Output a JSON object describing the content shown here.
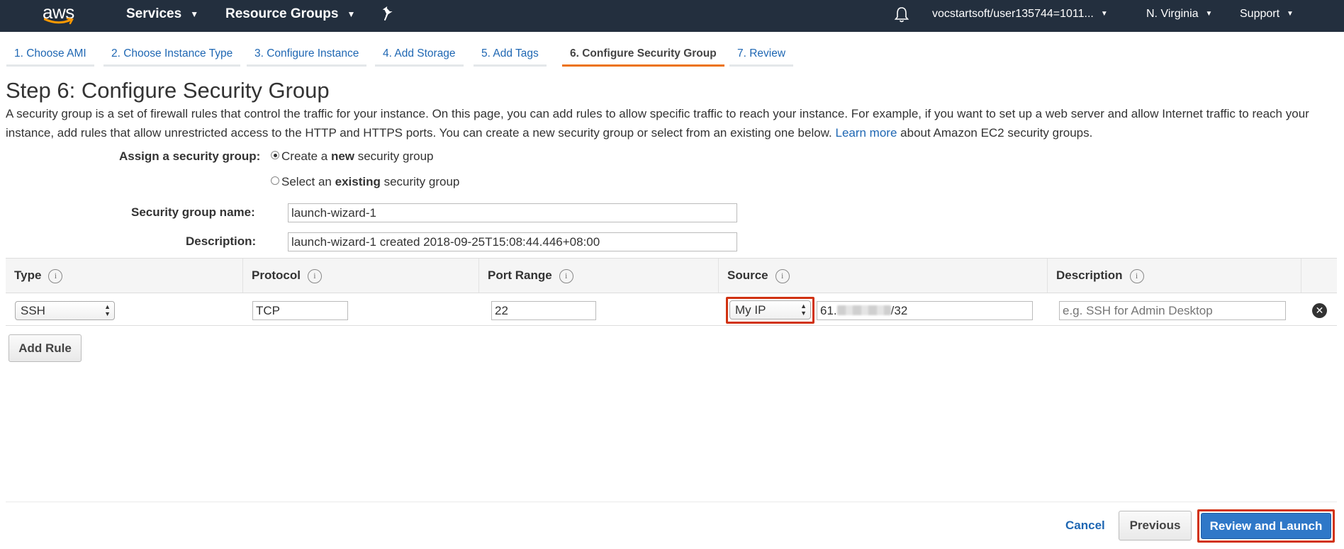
{
  "topbar": {
    "logo_text": "aws",
    "services": "Services",
    "resource_groups": "Resource Groups",
    "account": "vocstartsoft/user135744=1011...",
    "region": "N. Virginia",
    "support": "Support"
  },
  "tabs": [
    {
      "label": "1. Choose AMI"
    },
    {
      "label": "2. Choose Instance Type"
    },
    {
      "label": "3. Configure Instance"
    },
    {
      "label": "4. Add Storage"
    },
    {
      "label": "5. Add Tags"
    },
    {
      "label": "6. Configure Security Group",
      "active": true
    },
    {
      "label": "7. Review"
    }
  ],
  "page": {
    "title": "Step 6: Configure Security Group",
    "intro_text": "A security group is a set of firewall rules that control the traffic for your instance. On this page, you can add rules to allow specific traffic to reach your instance. For example, if you want to set up a web server and allow Internet traffic to reach your instance, add rules that allow unrestricted access to the HTTP and HTTPS ports. You can create a new security group or select from an existing one below.",
    "learn_more": "Learn more",
    "intro_suffix": "about Amazon EC2 security groups."
  },
  "form": {
    "assign_label": "Assign a security group:",
    "option_new_prefix": "Create a ",
    "option_new_bold": "new",
    "option_new_suffix": " security group",
    "option_existing_prefix": "Select an ",
    "option_existing_bold": "existing",
    "option_existing_suffix": " security group",
    "selected_option": "new",
    "name_label": "Security group name:",
    "name_value": "launch-wizard-1",
    "description_label": "Description:",
    "description_value": "launch-wizard-1 created 2018-09-25T15:08:44.446+08:00"
  },
  "table": {
    "headers": [
      "Type",
      "Protocol",
      "Port Range",
      "Source",
      "Description"
    ],
    "rows": [
      {
        "type": "SSH",
        "protocol": "TCP",
        "port_range": "22",
        "source_select": "My IP",
        "source_ip_prefix": "61.",
        "source_ip_suffix": "/32",
        "description_placeholder": "e.g. SSH for Admin Desktop"
      }
    ]
  },
  "buttons": {
    "add_rule": "Add Rule",
    "cancel": "Cancel",
    "previous": "Previous",
    "review_and_launch": "Review and Launch"
  },
  "colors": {
    "navbar": "#232f3e",
    "link": "#1f67b3",
    "active_tab_underline": "#ec7211",
    "highlight": "#d13212",
    "primary_button": "#2f78c8"
  },
  "icons": {
    "pin": "pin-icon",
    "bell": "bell-icon",
    "info": "info-icon",
    "remove": "remove-circle-icon"
  }
}
